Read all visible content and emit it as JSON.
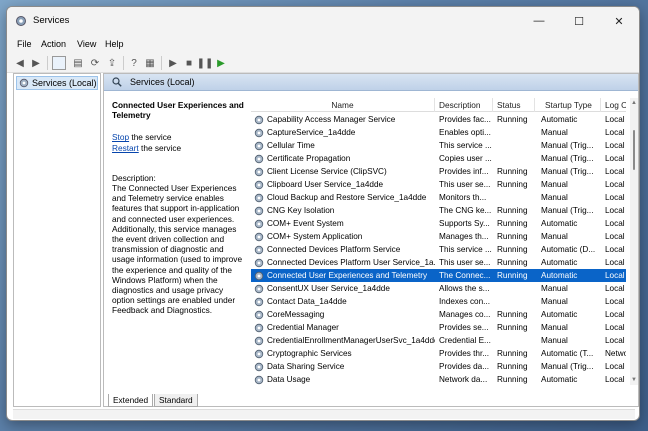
{
  "window": {
    "title": "Services"
  },
  "titlebar": {
    "minimize": "—",
    "maximize": "☐",
    "close": "✕"
  },
  "menu": [
    "File",
    "Action",
    "View",
    "Help"
  ],
  "tree": {
    "item": "Services (Local)"
  },
  "pane": {
    "header": "Services (Local)"
  },
  "description": {
    "title": "Connected User Experiences and Telemetry",
    "stop_link": "Stop",
    "stop_suffix": " the service",
    "restart_link": "Restart",
    "restart_suffix": " the service",
    "label": "Description:",
    "text": "The Connected User Experiences and Telemetry service enables features that support in-application and connected user experiences. Additionally, this service manages the event driven collection and transmission of diagnostic and usage information (used to improve the experience and quality of the Windows Platform) when the diagnostics and usage privacy option settings are enabled under Feedback and Diagnostics."
  },
  "columns": [
    "Name",
    "Description",
    "Status",
    "Startup Type",
    "Log O"
  ],
  "rows": [
    [
      "Capability Access Manager Service",
      "Provides fac...",
      "Running",
      "Automatic",
      "Local"
    ],
    [
      "CaptureService_1a4dde",
      "Enables opti...",
      "",
      "Manual",
      "Local"
    ],
    [
      "Cellular Time",
      "This service ...",
      "",
      "Manual (Trig...",
      "Local"
    ],
    [
      "Certificate Propagation",
      "Copies user ...",
      "",
      "Manual (Trig...",
      "Local"
    ],
    [
      "Client License Service (ClipSVC)",
      "Provides inf...",
      "Running",
      "Manual (Trig...",
      "Local"
    ],
    [
      "Clipboard User Service_1a4dde",
      "This user se...",
      "Running",
      "Manual",
      "Local"
    ],
    [
      "Cloud Backup and Restore Service_1a4dde",
      "Monitors th...",
      "",
      "Manual",
      "Local"
    ],
    [
      "CNG Key Isolation",
      "The CNG ke...",
      "Running",
      "Manual (Trig...",
      "Local"
    ],
    [
      "COM+ Event System",
      "Supports Sy...",
      "Running",
      "Automatic",
      "Local"
    ],
    [
      "COM+ System Application",
      "Manages th...",
      "Running",
      "Manual",
      "Local"
    ],
    [
      "Connected Devices Platform Service",
      "This service ...",
      "Running",
      "Automatic (D...",
      "Local"
    ],
    [
      "Connected Devices Platform User Service_1a...",
      "This user se...",
      "Running",
      "Automatic",
      "Local"
    ],
    [
      "Connected User Experiences and Telemetry",
      "The Connec...",
      "Running",
      "Automatic",
      "Local"
    ],
    [
      "ConsentUX User Service_1a4dde",
      "Allows the s...",
      "",
      "Manual",
      "Local"
    ],
    [
      "Contact Data_1a4dde",
      "Indexes con...",
      "",
      "Manual",
      "Local"
    ],
    [
      "CoreMessaging",
      "Manages co...",
      "Running",
      "Automatic",
      "Local"
    ],
    [
      "Credential Manager",
      "Provides se...",
      "Running",
      "Manual",
      "Local"
    ],
    [
      "CredentialEnrollmentManagerUserSvc_1a4dde",
      "Credential E...",
      "",
      "Manual",
      "Local"
    ],
    [
      "Cryptographic Services",
      "Provides thr...",
      "Running",
      "Automatic (T...",
      "Netwo"
    ],
    [
      "Data Sharing Service",
      "Provides da...",
      "Running",
      "Manual (Trig...",
      "Local"
    ],
    [
      "Data Usage",
      "Network da...",
      "Running",
      "Automatic",
      "Local"
    ]
  ],
  "selected_row": 12,
  "tabs": [
    "Extended",
    "Standard"
  ],
  "colors": {
    "selection": "#0a64c8",
    "header_gradient_top": "#d8e4f2",
    "link": "#0645ad"
  }
}
